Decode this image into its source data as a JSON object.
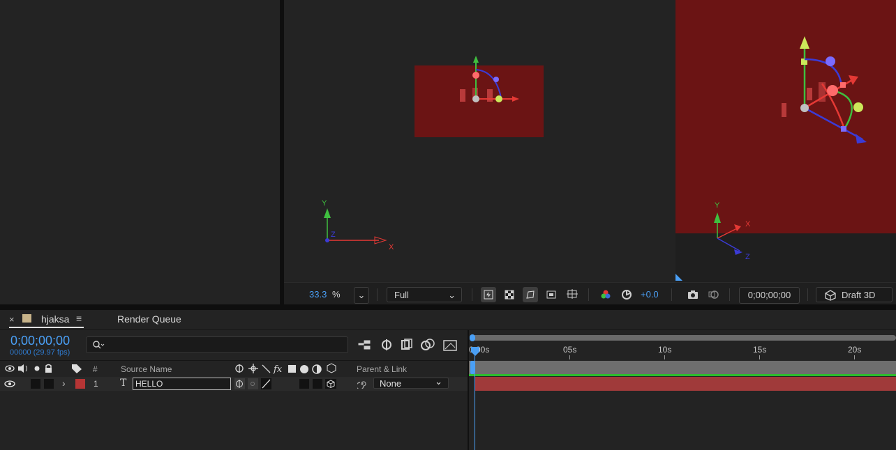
{
  "viewer": {
    "zoom_value": "33.3",
    "zoom_unit": "%",
    "resolution": "Full",
    "exposure": "+0.0",
    "timecode": "0;00;00;00",
    "renderer": "Draft 3D",
    "axis_x": "X",
    "axis_y": "Y",
    "axis_z": "Z"
  },
  "timeline": {
    "tabs": [
      {
        "label": "hjaksa"
      },
      {
        "label": "Render Queue"
      }
    ],
    "current_time": "0;00;00;00",
    "frame_info": "00000 (29.97 fps)",
    "columns": {
      "hash": "#",
      "source_name": "Source Name",
      "parent_link": "Parent & Link"
    },
    "ruler": [
      "0:00s",
      "05s",
      "10s",
      "15s",
      "20s"
    ],
    "layers": [
      {
        "number": "1",
        "type_glyph": "T",
        "name": "HELLO",
        "parent": "None",
        "label_color": "#b53535"
      }
    ]
  },
  "colors": {
    "accent": "#4a9ff5",
    "layer_bar": "#a03a3a",
    "solid": "#6b1414",
    "x_axis": "#e53935",
    "y_axis": "#3fbf3f",
    "z_axis": "#3b3bd6"
  }
}
